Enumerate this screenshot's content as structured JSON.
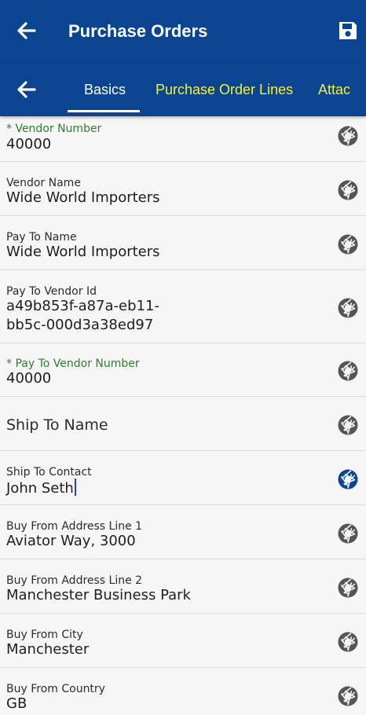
{
  "header": {
    "title": "Purchase Orders",
    "back_icon": "arrow-left-icon",
    "save_icon": "floppy-disk-icon",
    "color": "#0b4592"
  },
  "tabs": {
    "back_icon": "arrow-left-icon",
    "items": [
      {
        "label": "Basics",
        "active": true
      },
      {
        "label": "Purchase Order Lines",
        "active": false
      },
      {
        "label": "Attac",
        "active": false
      }
    ],
    "active_color": "#ffffff",
    "inactive_color": "#f2f23a"
  },
  "fields": [
    {
      "label": "* Vendor Number",
      "value": "40000",
      "required": true
    },
    {
      "label": "Vendor Name",
      "value": "Wide World Importers",
      "required": false
    },
    {
      "label": "Pay To Name",
      "value": "Wide World Importers",
      "required": false
    },
    {
      "label": "Pay To Vendor Id",
      "value_line1": "a49b853f-a87a-eb11-",
      "value_line2": "bb5c-000d3a38ed97",
      "required": false
    },
    {
      "label": "* Pay To Vendor Number",
      "value": "40000",
      "required": true
    },
    {
      "placeholder": "Ship To Name",
      "value": ""
    },
    {
      "label": "Ship To Contact",
      "value": "John Seth",
      "focused": true
    },
    {
      "label": "Buy From Address Line 1",
      "value": "Aviator Way, 3000"
    },
    {
      "label": "Buy From Address Line 2",
      "value": "Manchester Business Park"
    },
    {
      "label": "Buy From City",
      "value": "Manchester"
    },
    {
      "label": "Buy From Country",
      "value": "GB"
    }
  ],
  "camera_icon": "camera-shutter-icon",
  "camera_color": "#555555",
  "camera_active_color": "#0b4592"
}
